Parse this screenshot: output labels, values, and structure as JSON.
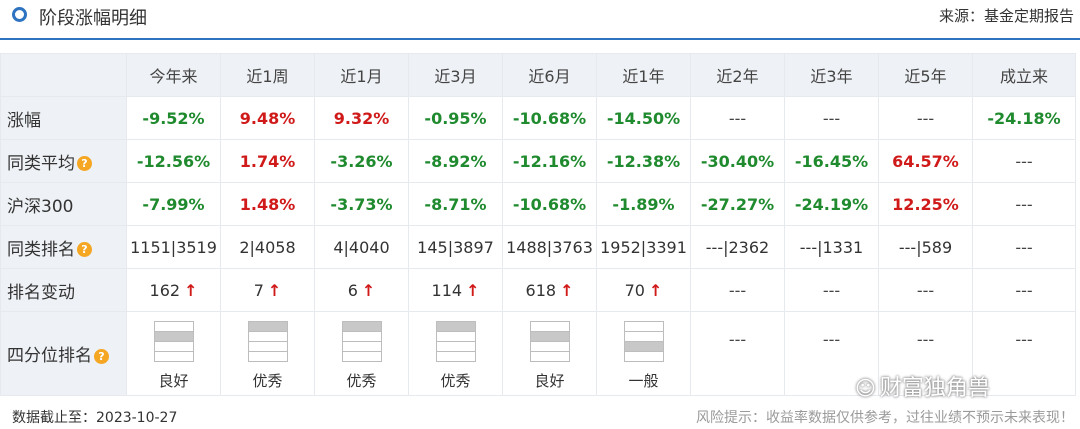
{
  "header": {
    "title": "阶段涨幅明细",
    "source_label": "来源：",
    "source_value": "基金定期报告"
  },
  "columns": [
    "",
    "今年来",
    "近1周",
    "近1月",
    "近3月",
    "近6月",
    "近1年",
    "近2年",
    "近3年",
    "近5年",
    "成立来"
  ],
  "rows": {
    "gain": {
      "label": "涨幅",
      "values": [
        "-9.52%",
        "9.48%",
        "9.32%",
        "-0.95%",
        "-10.68%",
        "-14.50%",
        "---",
        "---",
        "---",
        "-24.18%"
      ]
    },
    "peer_avg": {
      "label": "同类平均",
      "values": [
        "-12.56%",
        "1.74%",
        "-3.26%",
        "-8.92%",
        "-12.16%",
        "-12.38%",
        "-30.40%",
        "-16.45%",
        "64.57%",
        "---"
      ]
    },
    "hs300": {
      "label": "沪深300",
      "values": [
        "-7.99%",
        "1.48%",
        "-3.73%",
        "-8.71%",
        "-10.68%",
        "-1.89%",
        "-27.27%",
        "-24.19%",
        "12.25%",
        "---"
      ]
    },
    "peer_rank": {
      "label": "同类排名",
      "values": [
        "1151|3519",
        "2|4058",
        "4|4040",
        "145|3897",
        "1488|3763",
        "1952|3391",
        "---|2362",
        "---|1331",
        "---|589",
        "---"
      ]
    },
    "rank_change": {
      "label": "排名变动",
      "values": [
        "162",
        "7",
        "6",
        "114",
        "618",
        "70",
        "---",
        "---",
        "---",
        "---"
      ],
      "arrow": "↑"
    },
    "quartile": {
      "label": "四分位排名",
      "values": [
        "良好",
        "优秀",
        "优秀",
        "优秀",
        "良好",
        "一般",
        "---",
        "---",
        "---",
        "---"
      ],
      "levels": [
        2,
        1,
        1,
        1,
        2,
        3
      ]
    }
  },
  "help_icon": "?",
  "footer": {
    "date_label": "数据截止至：",
    "date_value": "2023-10-27",
    "risk_notice": "风险提示：收益率数据仅供参考，过往业绩不预示未来表现！"
  },
  "watermark": "财富独角兽",
  "colors": {
    "negative": "#1f8a2e",
    "positive": "#d01a1a",
    "accent": "#2e73c0",
    "help": "#f5a623"
  }
}
